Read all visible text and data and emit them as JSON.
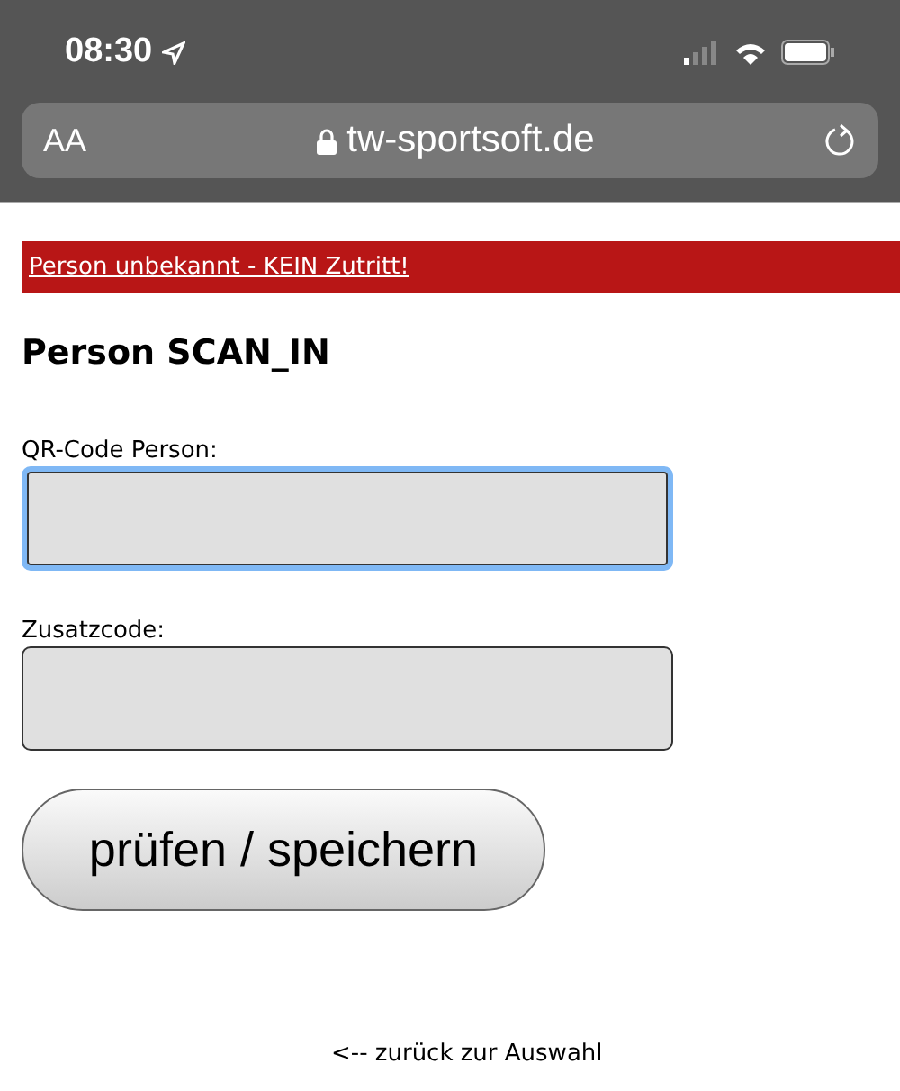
{
  "status_bar": {
    "time": "08:30"
  },
  "browser": {
    "text_size_label": "AA",
    "url": "tw-sportsoft.de"
  },
  "alert": {
    "text": "Person unbekannt - KEIN Zutritt!"
  },
  "heading": "Person SCAN_IN",
  "fields": [
    {
      "label": "QR-Code Person:",
      "focused": true
    },
    {
      "label": "Zusatzcode:",
      "focused": false
    }
  ],
  "submit_button": "prüfen / speichern",
  "back_link": "<-- zurück zur Auswahl"
}
